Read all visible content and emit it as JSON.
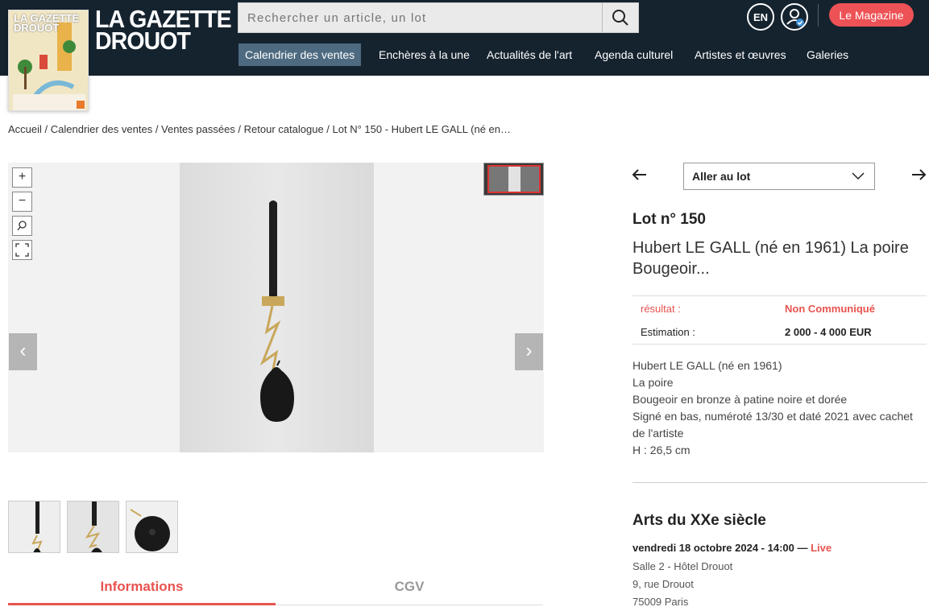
{
  "header": {
    "logo_line1": "LA GAZETTE",
    "logo_line2": "DROUOT",
    "magazine_cover_title": "LA GAZETTE DROUOT",
    "search_placeholder": "Rechercher un article, un lot",
    "lang": "EN",
    "magazine_button": "Le Magazine",
    "nav": [
      "Calendrier des ventes",
      "Enchères à la une",
      "Actualités de l'art",
      "Agenda culturel",
      "Artistes et œuvres",
      "Galeries"
    ]
  },
  "breadcrumb": "Accueil / Calendrier des ventes / Ventes passées / Retour catalogue / Lot N°  150 - Hubert LE GALL (né en…",
  "viewer": {
    "zoom_in": "+",
    "zoom_out": "−",
    "prev": "‹",
    "next": "›"
  },
  "tabs": {
    "informations": "Informations",
    "cgv": "CGV"
  },
  "lot": {
    "goto_label": "Aller au lot",
    "number": "Lot n° 150",
    "title": "Hubert LE GALL (né en 1961) La poire Bougeoir...",
    "result_label": "résultat :",
    "result_value": "Non Communiqué",
    "estimate_label": "Estimation :",
    "estimate_value": "2 000 - 4 000 EUR",
    "description": [
      "Hubert LE GALL (né en 1961)",
      "La poire",
      "Bougeoir en bronze à patine noire et dorée",
      "Signé en bas, numéroté 13/30 et daté 2021 avec cachet de l'artiste",
      "H : 26,5 cm"
    ]
  },
  "sale": {
    "title": "Arts du XXe siècle",
    "date": "vendredi 18 octobre 2024 - 14:00 —",
    "live": "Live",
    "address": [
      "Salle 2 - Hôtel Drouot",
      "9, rue Drouot",
      "75009 Paris"
    ]
  },
  "colors": {
    "header_bg": "#15232f",
    "accent": "#ed5256",
    "nav_active": "#4d6a80"
  }
}
